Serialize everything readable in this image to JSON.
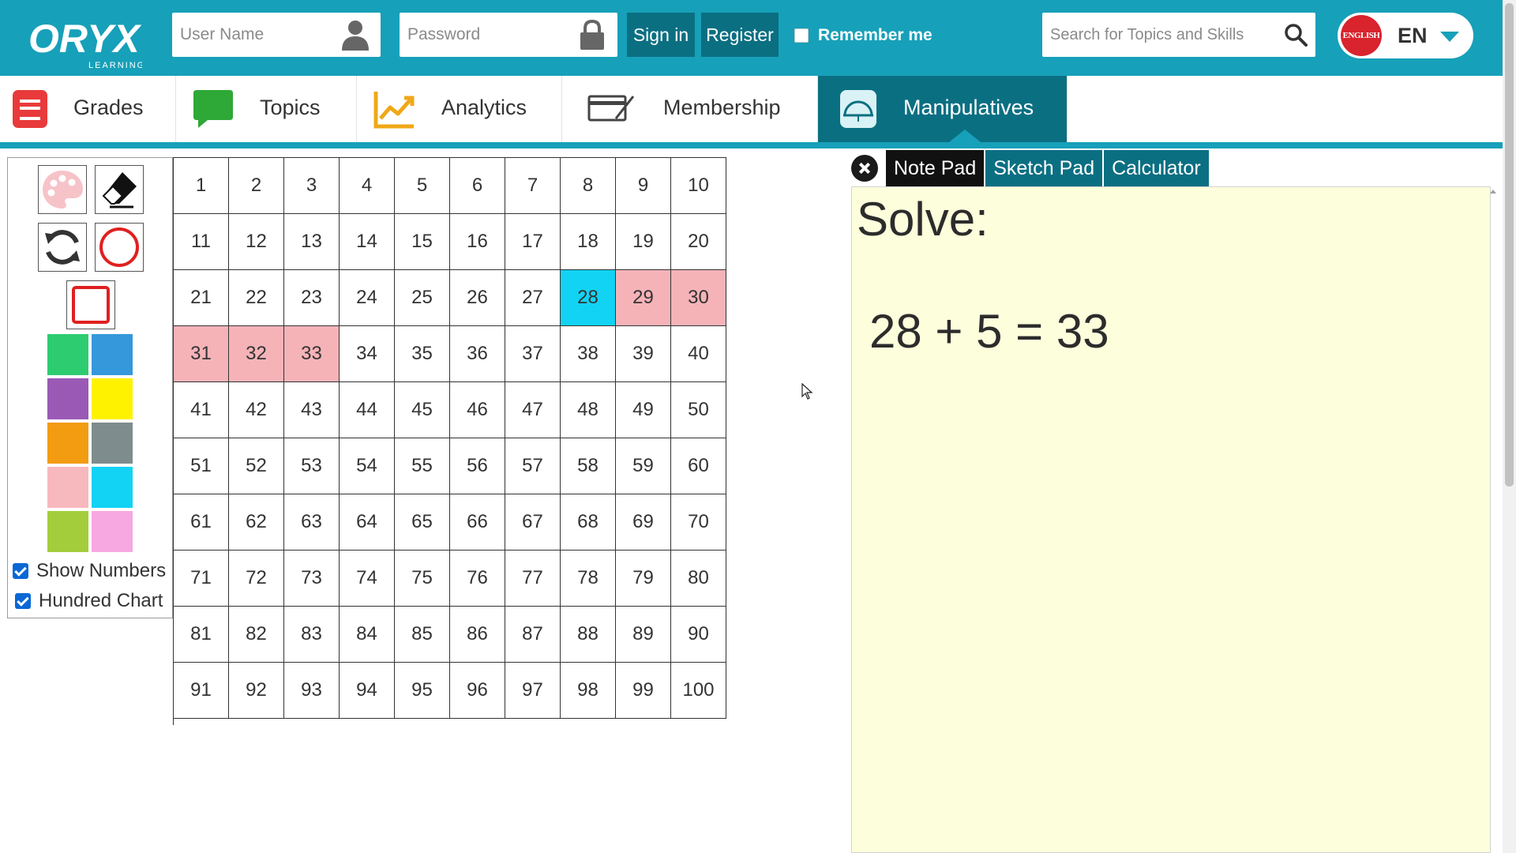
{
  "header": {
    "logo_text": "ORYX",
    "logo_subtext": "LEARNING",
    "username_placeholder": "User Name",
    "password_placeholder": "Password",
    "sign_in_label": "Sign in",
    "register_label": "Register",
    "remember_label": "Remember me",
    "search_placeholder": "Search for Topics and Skills",
    "language_flag_text": "ENGLISH",
    "language_code": "EN"
  },
  "nav": {
    "items": [
      {
        "label": "Grades",
        "icon": "book-icon"
      },
      {
        "label": "Topics",
        "icon": "chat-bubble-icon"
      },
      {
        "label": "Analytics",
        "icon": "line-chart-icon"
      },
      {
        "label": "Membership",
        "icon": "card-pen-icon"
      },
      {
        "label": "Manipulatives",
        "icon": "protractor-icon",
        "active": true
      }
    ]
  },
  "toolbox": {
    "tools": [
      "palette-icon",
      "eraser-icon",
      "refresh-icon",
      "circle-icon",
      "square-icon"
    ],
    "swatches": [
      "#2ecc71",
      "#3498db",
      "#9b59b6",
      "#fff200",
      "#f39c12",
      "#7f8c8d",
      "#f8b9be",
      "#12d3f3",
      "#a3cd3b",
      "#f7a8e0"
    ],
    "show_numbers_label": "Show Numbers",
    "hundred_chart_label": "Hundred Chart"
  },
  "grid": {
    "cells": [
      "1",
      "2",
      "3",
      "4",
      "5",
      "6",
      "7",
      "8",
      "9",
      "10",
      "11",
      "12",
      "13",
      "14",
      "15",
      "16",
      "17",
      "18",
      "19",
      "20",
      "21",
      "22",
      "23",
      "24",
      "25",
      "26",
      "27",
      "28",
      "29",
      "30",
      "31",
      "32",
      "33",
      "34",
      "35",
      "36",
      "37",
      "38",
      "39",
      "40",
      "41",
      "42",
      "43",
      "44",
      "45",
      "46",
      "47",
      "48",
      "49",
      "50",
      "51",
      "52",
      "53",
      "54",
      "55",
      "56",
      "57",
      "58",
      "59",
      "60",
      "61",
      "62",
      "63",
      "64",
      "65",
      "66",
      "67",
      "68",
      "69",
      "70",
      "71",
      "72",
      "73",
      "74",
      "75",
      "76",
      "77",
      "78",
      "79",
      "80",
      "81",
      "82",
      "83",
      "84",
      "85",
      "86",
      "87",
      "88",
      "89",
      "90",
      "91",
      "92",
      "93",
      "94",
      "95",
      "96",
      "97",
      "98",
      "99",
      "100"
    ],
    "blue_cells": [
      28
    ],
    "pink_cells": [
      29,
      30,
      31,
      32,
      33
    ],
    "blue_color": "#12d3f3",
    "pink_color": "#f5b3b8"
  },
  "notepad": {
    "tabs": [
      "Note Pad",
      "Sketch Pad",
      "Calculator"
    ],
    "active_tab": "Note Pad",
    "title": "Solve:",
    "equation": "28 + 5 = 33"
  },
  "colors": {
    "header_bg": "#17a0b9",
    "button_bg": "#0b6f82",
    "pad_bg": "#fdfedc"
  }
}
